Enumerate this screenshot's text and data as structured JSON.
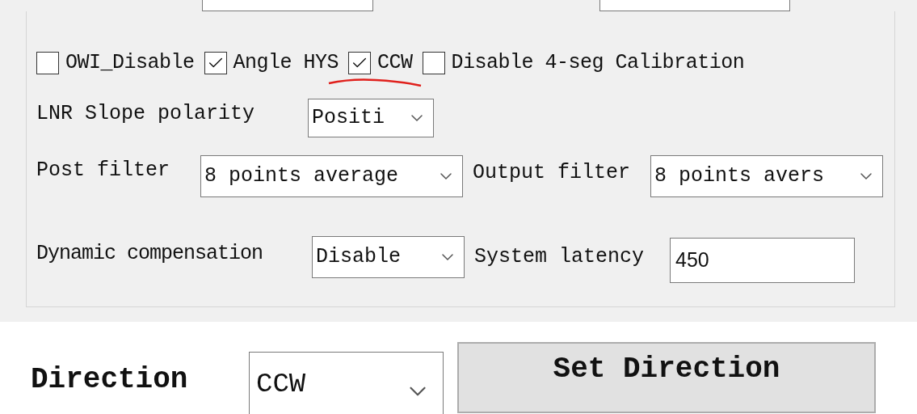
{
  "top_fields": [
    {
      "kind": "input"
    },
    {
      "kind": "input"
    }
  ],
  "checkboxes": [
    {
      "label": "OWI_Disable",
      "checked": false,
      "annotated": false
    },
    {
      "label": "Angle HYS",
      "checked": true,
      "annotated": false
    },
    {
      "label": "CCW",
      "checked": true,
      "annotated": true
    },
    {
      "label": "Disable 4-seg Calibration",
      "checked": false,
      "annotated": false
    }
  ],
  "lnr_slope_polarity": {
    "label": "LNR Slope polarity",
    "value": "Positi"
  },
  "post_filter": {
    "label": "Post filter",
    "value": "8 points average"
  },
  "output_filter": {
    "label": "Output filter",
    "value": "8 points avers"
  },
  "dynamic_compensation": {
    "label": "Dynamic compensation",
    "value": "Disable"
  },
  "system_latency": {
    "label": "System latency",
    "value": "450"
  },
  "direction": {
    "label": "Direction",
    "value": "CCW"
  },
  "set_direction_button": "Set Direction"
}
